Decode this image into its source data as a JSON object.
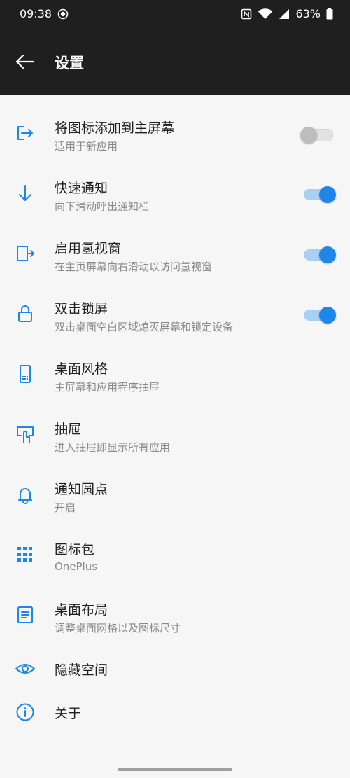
{
  "status": {
    "time": "09:38",
    "battery": "63%"
  },
  "header": {
    "title": "设置"
  },
  "colors": {
    "accent": "#1e86e8",
    "header_bg": "#1f1f1f",
    "background": "#f6f6f6"
  },
  "items": [
    {
      "title": "将图标添加到主屏幕",
      "subtitle": "适用于新应用",
      "icon": "add-to-home-icon",
      "toggle": "off"
    },
    {
      "title": "快速通知",
      "subtitle": "向下滑动呼出通知栏",
      "icon": "arrow-down-icon",
      "toggle": "on"
    },
    {
      "title": "启用氢视窗",
      "subtitle": "在主页屏幕向右滑动以访问氢视窗",
      "icon": "hydrogen-window-icon",
      "toggle": "on"
    },
    {
      "title": "双击锁屏",
      "subtitle": "双击桌面空白区域熄灭屏幕和锁定设备",
      "icon": "lock-icon",
      "toggle": "on"
    },
    {
      "title": "桌面风格",
      "subtitle": "主屏幕和应用程序抽屉",
      "icon": "phone-icon"
    },
    {
      "title": "抽屉",
      "subtitle": "进入抽屉即显示所有应用",
      "icon": "drawer-icon"
    },
    {
      "title": "通知圆点",
      "subtitle": "开启",
      "icon": "bell-icon"
    },
    {
      "title": "图标包",
      "subtitle": "OnePlus",
      "icon": "grid-icon"
    },
    {
      "title": "桌面布局",
      "subtitle": "调整桌面网格以及图标尺寸",
      "icon": "layout-icon"
    },
    {
      "title": "隐藏空间",
      "icon": "eye-icon"
    },
    {
      "title": "关于",
      "icon": "info-icon"
    }
  ]
}
